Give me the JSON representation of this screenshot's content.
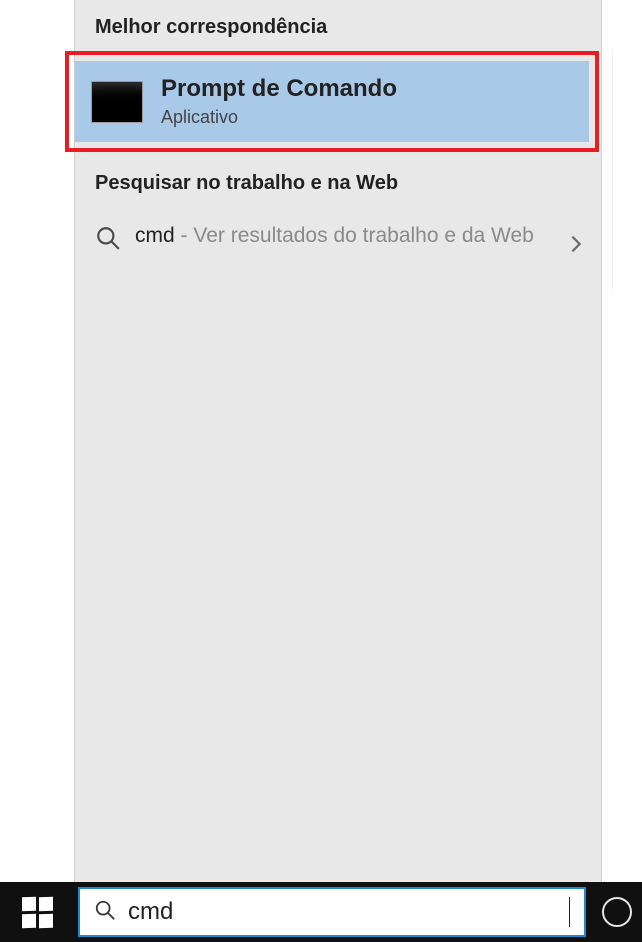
{
  "sections": {
    "best_match_heading": "Melhor correspondência",
    "search_web_heading": "Pesquisar no trabalho e na Web"
  },
  "best_match": {
    "title": "Prompt de Comando",
    "subtitle": "Aplicativo"
  },
  "web_result": {
    "query": "cmd",
    "hint_prefix": " - ",
    "hint": "Ver resultados do trabalho e da Web"
  },
  "search": {
    "value": "cmd",
    "placeholder": ""
  }
}
